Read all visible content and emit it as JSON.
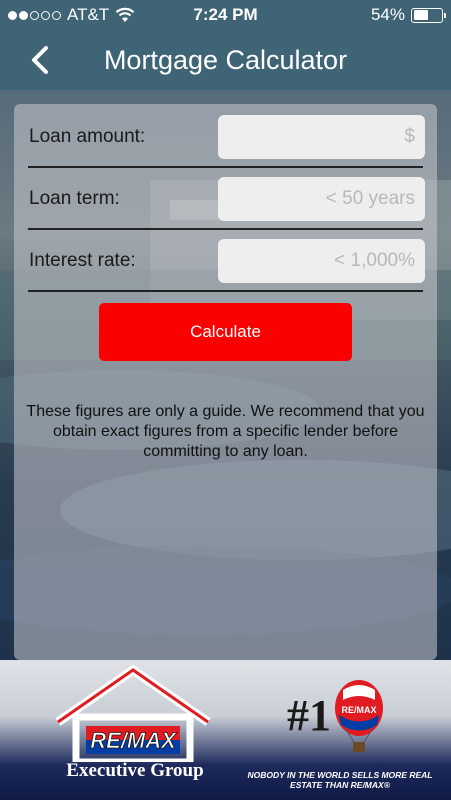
{
  "status_bar": {
    "carrier": "AT&T",
    "time": "7:24 PM",
    "battery": "54%",
    "battery_level": 0.54,
    "signal_bars": 2
  },
  "nav": {
    "title": "Mortgage Calculator",
    "back_icon": "chevron-left-icon"
  },
  "form": {
    "fields": [
      {
        "label": "Loan amount:",
        "placeholder": "$",
        "value": ""
      },
      {
        "label": "Loan term:",
        "placeholder": "< 50 years",
        "value": ""
      },
      {
        "label": "Interest rate:",
        "placeholder": "< 1,000%",
        "value": ""
      }
    ],
    "calculate_label": "Calculate",
    "disclaimer": "These figures are only a guide. We recommend that you obtain exact figures from a specific lender before committing to any loan."
  },
  "footer": {
    "logo_text": "RE/MAX",
    "brand": "Executive Group",
    "tagline": "NOBODY IN THE WORLD SELLS MORE REAL ESTATE THAN RE/MAX®",
    "colors": {
      "red": "#e11b22",
      "blue": "#003da5"
    }
  },
  "colors": {
    "nav_bg": "#3f6476",
    "button": "#fb0000"
  }
}
